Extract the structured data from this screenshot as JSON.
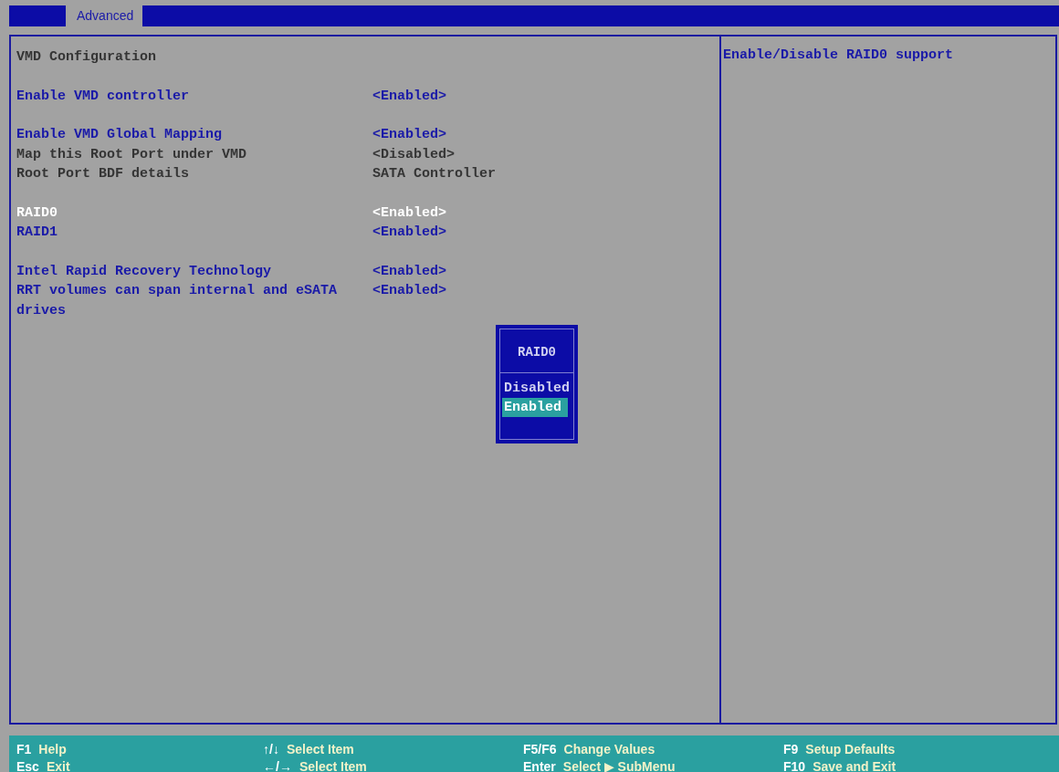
{
  "tabs": [
    {
      "label": "Advanced",
      "selected": true
    }
  ],
  "groups": [
    {
      "rows": [
        {
          "kind": "header",
          "label": "VMD Configuration"
        }
      ]
    },
    {
      "rows": [
        {
          "kind": "option",
          "label": "Enable VMD controller",
          "value": "<Enabled>",
          "selected": false
        }
      ]
    },
    {
      "rows": [
        {
          "kind": "option",
          "label": "Enable VMD Global Mapping",
          "value": "<Enabled>",
          "selected": false
        },
        {
          "kind": "info",
          "label": "Map this Root Port under VMD",
          "value": "<Disabled>"
        },
        {
          "kind": "info",
          "label": "Root Port BDF details",
          "value": "SATA Controller"
        }
      ]
    },
    {
      "rows": [
        {
          "kind": "option",
          "label": "RAID0",
          "value": "<Enabled>",
          "selected": true
        },
        {
          "kind": "option",
          "label": "RAID1",
          "value": "<Enabled>",
          "selected": false
        }
      ]
    },
    {
      "rows": [
        {
          "kind": "option",
          "label": "Intel Rapid Recovery Technology",
          "value": "<Enabled>",
          "selected": false
        },
        {
          "kind": "option",
          "label": "RRT volumes can span internal and eSATA drives",
          "value": "<Enabled>",
          "selected": false
        }
      ]
    }
  ],
  "help_text": "Enable/Disable RAID0 support",
  "popup": {
    "title": "RAID0",
    "options": [
      {
        "label": "Disabled",
        "selected": false
      },
      {
        "label": "Enabled",
        "selected": true
      }
    ]
  },
  "footer": [
    [
      {
        "key": "F1",
        "action": "Help"
      },
      {
        "key": "Esc",
        "action": "Exit"
      }
    ],
    [
      {
        "key": "↑/↓",
        "action": "Select Item"
      },
      {
        "key": "←/→",
        "action": "Select Item"
      }
    ],
    [
      {
        "key": "F5/F6",
        "action": "Change Values"
      },
      {
        "key": "Enter",
        "action": "Select ▶ SubMenu"
      }
    ],
    [
      {
        "key": "F9",
        "action": "Setup Defaults"
      },
      {
        "key": "F10",
        "action": "Save and Exit"
      }
    ]
  ]
}
